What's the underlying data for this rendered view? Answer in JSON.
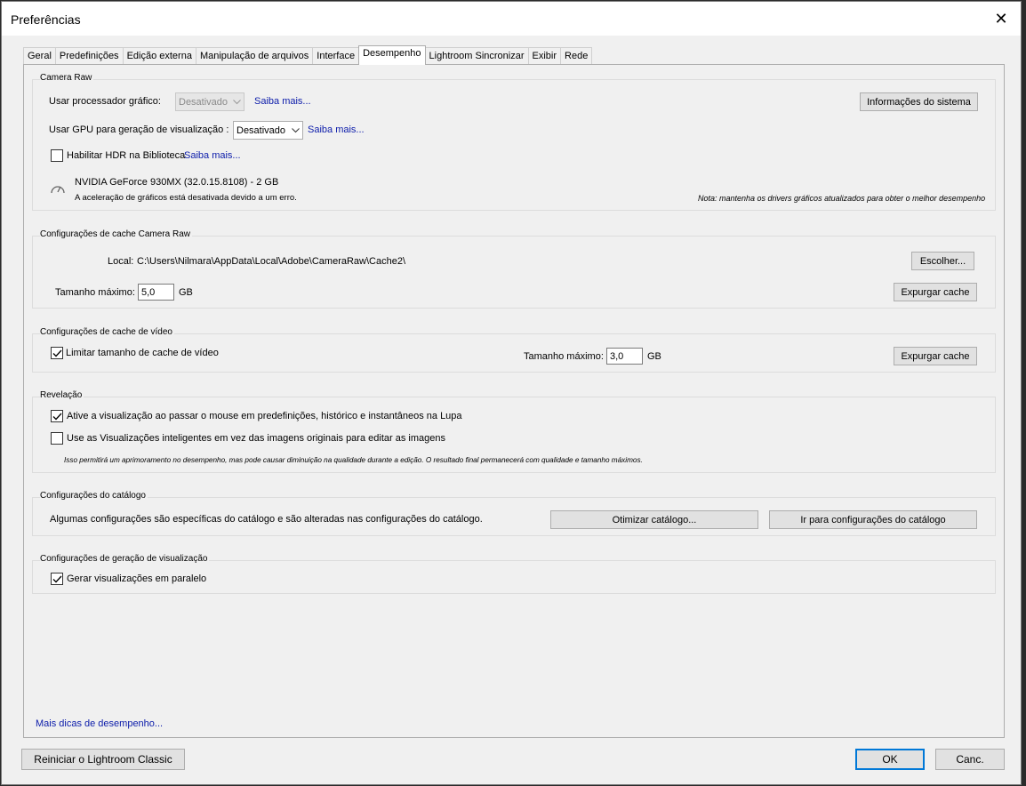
{
  "window": {
    "title": "Preferências"
  },
  "tabs": [
    "Geral",
    "Predefinições",
    "Edição externa",
    "Manipulação de arquivos",
    "Interface",
    "Desempenho",
    "Lightroom Sincronizar",
    "Exibir",
    "Rede"
  ],
  "active_tab": "Desempenho",
  "camera_raw": {
    "title": "Camera Raw",
    "gpu_label": "Usar processador gráfico:",
    "gpu_value": "Desativado",
    "gpu_link": "Saiba mais...",
    "gpu_preview_label": "Usar GPU para geração de visualização :",
    "gpu_preview_value": "Desativado",
    "gpu_preview_link": "Saiba mais...",
    "hdr_label": "Habilitar HDR na Biblioteca",
    "hdr_checked": false,
    "hdr_link": "Saiba mais...",
    "gpu_name": "NVIDIA GeForce 930MX (32.0.15.8108) - 2 GB",
    "gpu_status": "A aceleração de gráficos está desativada devido a um erro.",
    "note": "Nota: mantenha os drivers gráficos atualizados para obter o melhor desempenho",
    "system_info_button": "Informações do sistema"
  },
  "cache": {
    "title": "Configurações de cache Camera Raw",
    "location_label": "Local:",
    "location_value": "C:\\Users\\Nilmara\\AppData\\Local\\Adobe\\CameraRaw\\Cache2\\",
    "choose_button": "Escolher...",
    "max_size_label": "Tamanho máximo:",
    "max_size_value": "5,0",
    "unit": "GB",
    "purge_button": "Expurgar cache"
  },
  "video_cache": {
    "title": "Configurações de cache de vídeo",
    "limit_label": "Limitar tamanho de cache de vídeo",
    "limit_checked": true,
    "max_size_label": "Tamanho máximo:",
    "max_size_value": "3,0",
    "unit": "GB",
    "purge_button": "Expurgar cache"
  },
  "develop": {
    "title": "Revelação",
    "hover_label": "Ative a visualização ao passar o mouse em predefinições, histórico e instantâneos na Lupa",
    "hover_checked": true,
    "smart_label": "Use as Visualizações inteligentes em vez das imagens originais para editar as imagens",
    "smart_checked": false,
    "smart_note": "Isso permitirá um aprimoramento no desempenho, mas pode causar diminuição na qualidade durante a edição. O resultado final permanecerá com qualidade e tamanho máximos."
  },
  "catalog": {
    "title": "Configurações do catálogo",
    "description": "Algumas configurações são específicas do catálogo e são alteradas nas configurações do catálogo.",
    "optimize_button": "Otimizar catálogo...",
    "goto_button": "Ir para configurações do catálogo"
  },
  "preview": {
    "title": "Configurações de geração de visualização",
    "parallel_label": "Gerar visualizações em paralelo",
    "parallel_checked": true
  },
  "tips_link": "Mais dicas de desempenho...",
  "footer": {
    "restart_button": "Reiniciar o Lightroom Classic",
    "ok_button": "OK",
    "cancel_button": "Canc."
  }
}
